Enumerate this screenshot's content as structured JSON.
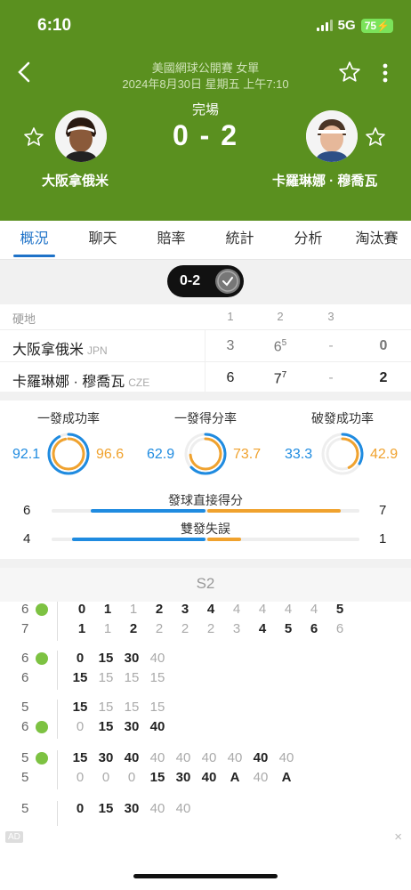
{
  "status_bar": {
    "time": "6:10",
    "network": "5G",
    "battery": "75"
  },
  "header": {
    "competition": "美國網球公開賽 女單",
    "datetime": "2024年8月30日 星期五 上午7:10",
    "status": "完場",
    "score": "0 - 2",
    "home": {
      "name": "大阪拿俄米"
    },
    "away": {
      "name": "卡羅琳娜 · 穆喬瓦"
    }
  },
  "tabs": [
    "概況",
    "聊天",
    "賠率",
    "統計",
    "分析",
    "淘汰賽"
  ],
  "set_pill": {
    "label": "0-2"
  },
  "sets_table": {
    "surface": "硬地",
    "set_headers": [
      "1",
      "2",
      "3"
    ],
    "rows": [
      {
        "name": "大阪拿俄米",
        "country": "JPN",
        "s1": "3",
        "s2": "6",
        "s2_tb": "5",
        "s3": "-",
        "total": "0"
      },
      {
        "name": "卡羅琳娜 · 穆喬瓦",
        "country": "CZE",
        "s1": "6",
        "s2": "7",
        "s2_tb": "7",
        "s3": "-",
        "total": "2"
      }
    ]
  },
  "ring_stats": [
    {
      "title": "一發成功率",
      "home": "92.1",
      "away": "96.6",
      "home_pct": 92.1,
      "away_pct": 96.6
    },
    {
      "title": "一發得分率",
      "home": "62.9",
      "away": "73.7",
      "home_pct": 62.9,
      "away_pct": 73.7
    },
    {
      "title": "破發成功率",
      "home": "33.3",
      "away": "42.9",
      "home_pct": 33.3,
      "away_pct": 42.9
    }
  ],
  "bar_stats": [
    {
      "title": "發球直接得分",
      "home": "6",
      "away": "7",
      "home_val": 6,
      "away_val": 7
    },
    {
      "title": "雙發失誤",
      "home": "4",
      "away": "1",
      "home_val": 4,
      "away_val": 1
    }
  ],
  "point_by_point": {
    "set_label": "S2",
    "game_progress": {
      "home": [
        "6",
        "0",
        "1",
        "1",
        "2",
        "3",
        "4",
        "4",
        "4",
        "4",
        "4",
        "5"
      ],
      "away": [
        "7",
        "1",
        "1",
        "2",
        "2",
        "2",
        "2",
        "3",
        "4",
        "5",
        "6",
        "6"
      ]
    },
    "games": [
      {
        "home_score": "6",
        "away_score": "6",
        "home_pts": [
          "0",
          "15",
          "30",
          "40"
        ],
        "away_pts": [
          "15",
          "15",
          "15",
          "15"
        ]
      },
      {
        "home_score": "5",
        "away_score": "6",
        "home_pts": [
          "15",
          "15",
          "15",
          "15"
        ],
        "away_pts": [
          "0",
          "15",
          "30",
          "40"
        ]
      },
      {
        "home_score": "5",
        "away_score": "5",
        "home_pts": [
          "15",
          "30",
          "40",
          "40",
          "40",
          "40",
          "40",
          "40",
          "40"
        ],
        "away_pts": [
          "0",
          "0",
          "0",
          "15",
          "30",
          "40",
          "A",
          "40",
          "A"
        ]
      },
      {
        "home_score": "5",
        "away_score": "",
        "home_pts": [
          "0",
          "15",
          "30",
          "40",
          "40"
        ],
        "away_pts": []
      }
    ]
  },
  "ad": {
    "label": "AD",
    "close": "×"
  },
  "colors": {
    "header_bg": "#5a901f",
    "home": "#1f8be0",
    "away": "#f0a22e",
    "accent": "#1e72c8"
  }
}
